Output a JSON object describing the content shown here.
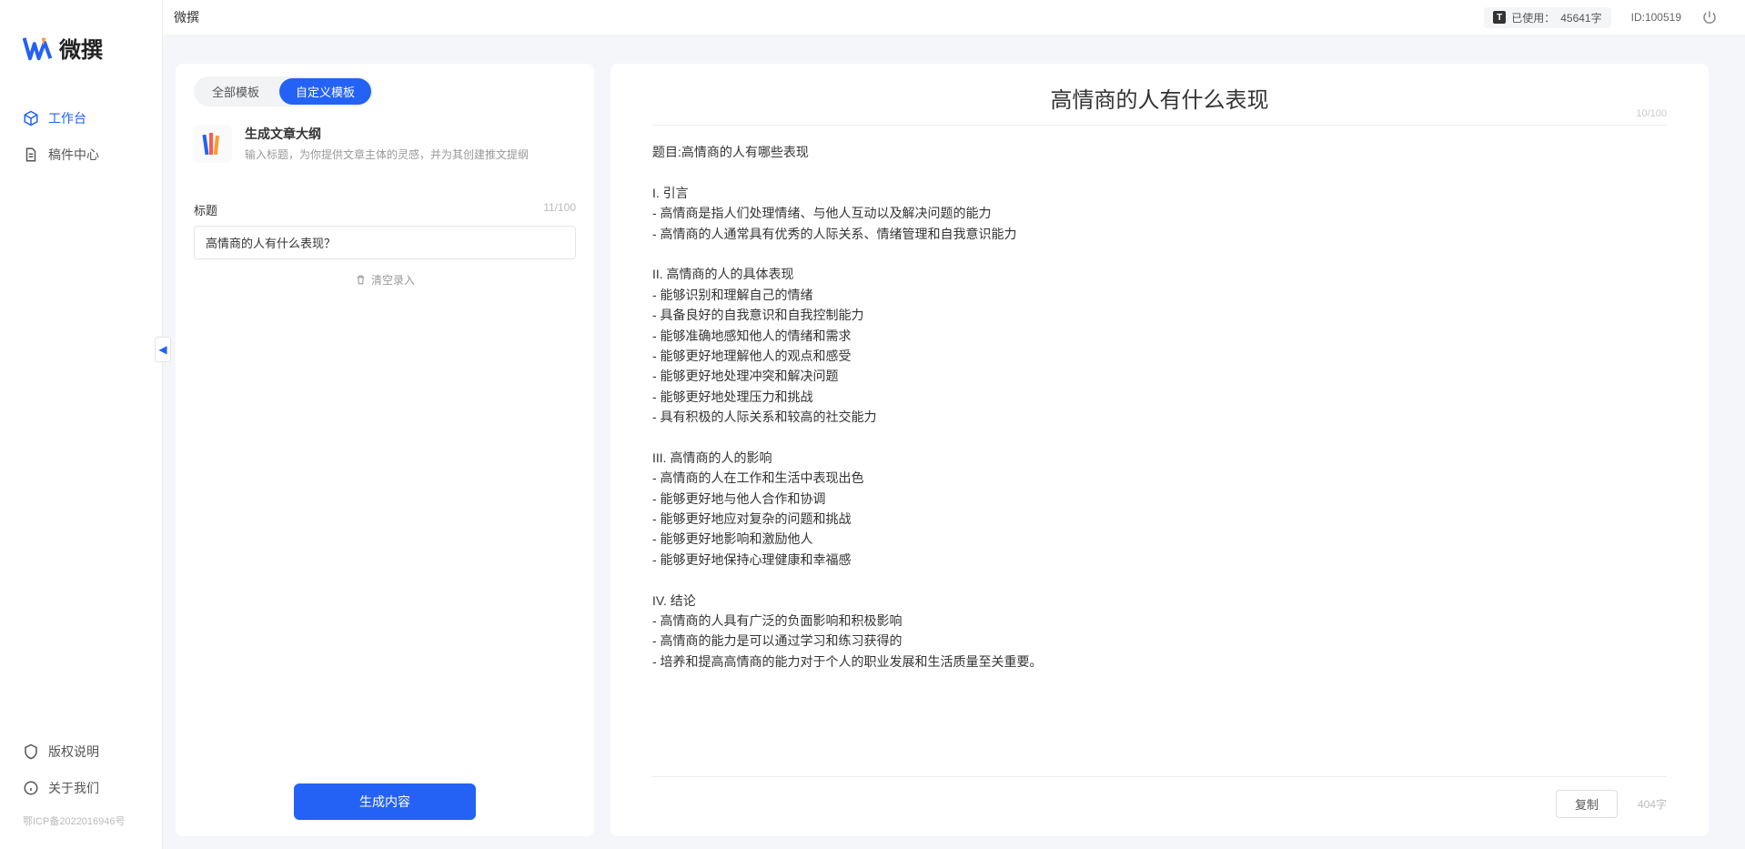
{
  "app": {
    "name": "微撰",
    "top_title": "微撰"
  },
  "topbar": {
    "usage_label": "已使用：",
    "usage_value": "45641字",
    "user_id": "ID:100519"
  },
  "sidebar": {
    "nav": [
      {
        "label": "工作台",
        "active": true
      },
      {
        "label": "稿件中心",
        "active": false
      }
    ],
    "bottom": [
      {
        "label": "版权说明"
      },
      {
        "label": "关于我们"
      }
    ],
    "icp": "鄂ICP备2022016946号"
  },
  "panel_left": {
    "tabs": [
      {
        "label": "全部模板",
        "active": false
      },
      {
        "label": "自定义模板",
        "active": true
      }
    ],
    "template": {
      "name": "生成文章大纲",
      "desc": "输入标题，为你提供文章主体的灵感，并为其创建推文提纲"
    },
    "form": {
      "title_label": "标题",
      "title_count": "11/100",
      "title_value": "高情商的人有什么表现？",
      "clear_label": "清空录入"
    },
    "generate_label": "生成内容"
  },
  "panel_right": {
    "title": "高情商的人有什么表现",
    "title_count": "10/100",
    "body": "题目:高情商的人有哪些表现\n\nI. 引言\n- 高情商是指人们处理情绪、与他人互动以及解决问题的能力\n- 高情商的人通常具有优秀的人际关系、情绪管理和自我意识能力\n\nII. 高情商的人的具体表现\n- 能够识别和理解自己的情绪\n- 具备良好的自我意识和自我控制能力\n- 能够准确地感知他人的情绪和需求\n- 能够更好地理解他人的观点和感受\n- 能够更好地处理冲突和解决问题\n- 能够更好地处理压力和挑战\n- 具有积极的人际关系和较高的社交能力\n\nIII. 高情商的人的影响\n- 高情商的人在工作和生活中表现出色\n- 能够更好地与他人合作和协调\n- 能够更好地应对复杂的问题和挑战\n- 能够更好地影响和激励他人\n- 能够更好地保持心理健康和幸福感\n\nIV. 结论\n- 高情商的人具有广泛的负面影响和积极影响\n- 高情商的能力是可以通过学习和练习获得的\n- 培养和提高高情商的能力对于个人的职业发展和生活质量至关重要。",
    "copy_label": "复制",
    "word_count": "404字"
  }
}
